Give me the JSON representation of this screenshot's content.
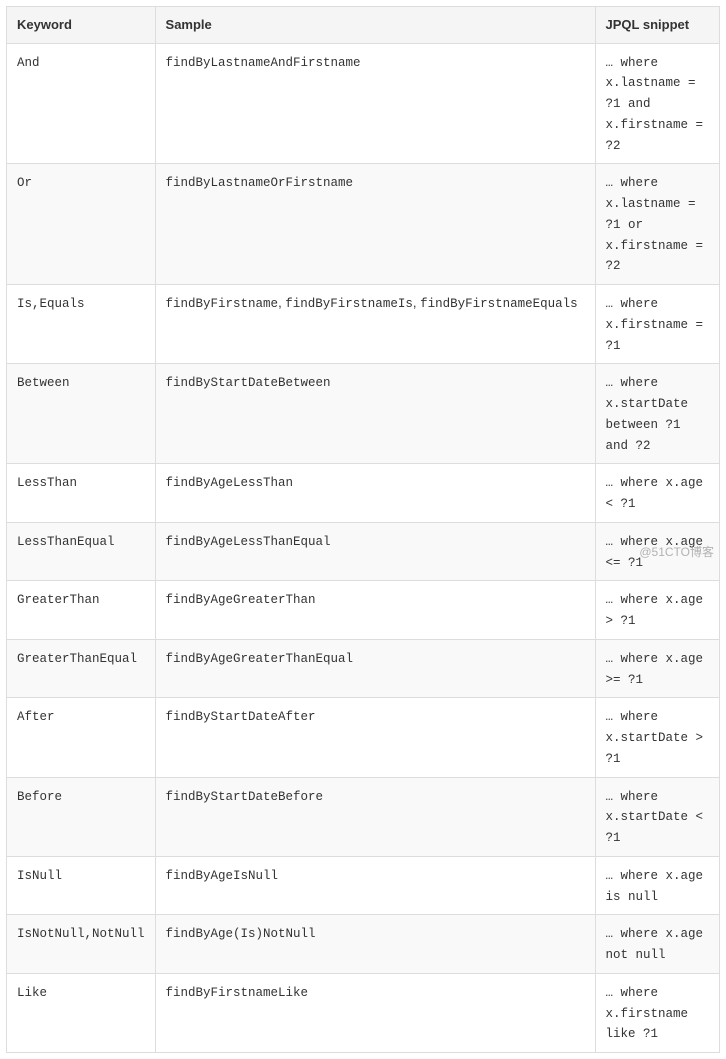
{
  "headers": {
    "keyword": "Keyword",
    "sample": "Sample",
    "snippet": "JPQL snippet"
  },
  "rows": [
    {
      "keyword": "And",
      "sample": "findByLastnameAndFirstname",
      "snippet": "… where x.lastname = ?1 and x.firstname = ?2"
    },
    {
      "keyword": "Or",
      "sample": "findByLastnameOrFirstname",
      "snippet": "… where x.lastname = ?1 or x.firstname = ?2"
    },
    {
      "keyword": "Is,Equals",
      "sample_parts": [
        "findByFirstname",
        "findByFirstnameIs",
        "findByFirstnameEquals"
      ],
      "snippet": "… where x.firstname = ?1"
    },
    {
      "keyword": "Between",
      "sample": "findByStartDateBetween",
      "snippet": "… where x.startDate between ?1 and ?2"
    },
    {
      "keyword": "LessThan",
      "sample": "findByAgeLessThan",
      "snippet": "… where x.age < ?1"
    },
    {
      "keyword": "LessThanEqual",
      "sample": "findByAgeLessThanEqual",
      "snippet": "… where x.age <= ?1"
    },
    {
      "keyword": "GreaterThan",
      "sample": "findByAgeGreaterThan",
      "snippet": "… where x.age > ?1"
    },
    {
      "keyword": "GreaterThanEqual",
      "sample": "findByAgeGreaterThanEqual",
      "snippet": "… where x.age >= ?1"
    },
    {
      "keyword": "After",
      "sample": "findByStartDateAfter",
      "snippet": "… where x.startDate > ?1"
    },
    {
      "keyword": "Before",
      "sample": "findByStartDateBefore",
      "snippet": "… where x.startDate < ?1"
    },
    {
      "keyword": "IsNull",
      "sample": "findByAgeIsNull",
      "snippet": "… where x.age is null"
    },
    {
      "keyword": "IsNotNull,NotNull",
      "sample": "findByAge(Is)NotNull",
      "snippet": "… where x.age not null"
    },
    {
      "keyword": "Like",
      "sample": "findByFirstnameLike",
      "snippet": "… where x.firstname like ?1"
    }
  ],
  "watermark": "@51CTO博客",
  "separator": ","
}
